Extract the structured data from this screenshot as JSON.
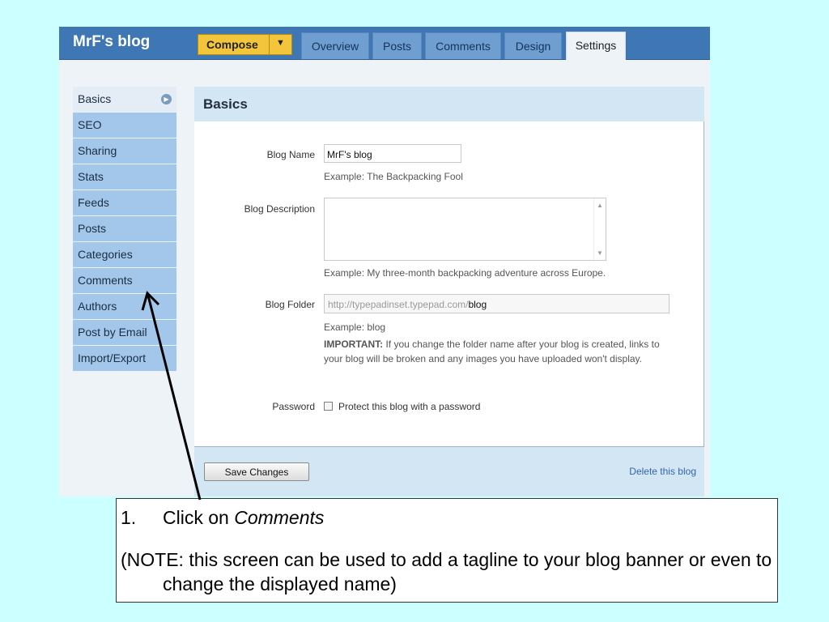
{
  "app": {
    "brand": "MrF's blog",
    "compose": {
      "label": "Compose",
      "caret": "▼"
    },
    "tabs": [
      {
        "label": "Overview"
      },
      {
        "label": "Posts"
      },
      {
        "label": "Comments"
      },
      {
        "label": "Design"
      },
      {
        "label": "Settings",
        "active": true
      }
    ]
  },
  "sidebar": {
    "items": [
      {
        "label": "Basics",
        "active": true
      },
      {
        "label": "SEO"
      },
      {
        "label": "Sharing"
      },
      {
        "label": "Stats"
      },
      {
        "label": "Feeds"
      },
      {
        "label": "Posts"
      },
      {
        "label": "Categories"
      },
      {
        "label": "Comments"
      },
      {
        "label": "Authors"
      },
      {
        "label": "Post by Email"
      },
      {
        "label": "Import/Export"
      }
    ]
  },
  "panel": {
    "title": "Basics",
    "blog_name": {
      "label": "Blog Name",
      "value": "MrF's blog",
      "example": "Example: The Backpacking Fool"
    },
    "blog_description": {
      "label": "Blog Description",
      "value": "",
      "example": "Example: My three-month backpacking adventure across Europe."
    },
    "blog_folder": {
      "label": "Blog Folder",
      "url_prefix": "http://typepadinset.typepad.com/",
      "value": "blog",
      "example": "Example: blog",
      "important_label": "IMPORTANT:",
      "important_text": "If you change the folder name after your blog is created, links to your blog will be broken and any images you have uploaded won't display."
    },
    "password": {
      "label": "Password",
      "checkbox_label": "Protect this blog with a password",
      "checked": false
    },
    "save_label": "Save Changes",
    "delete_label": "Delete this blog"
  },
  "note": {
    "step_number": "1.",
    "step_text_prefix": "Click on ",
    "step_text_emph": "Comments",
    "note_text": "(NOTE: this screen can be used to add a tagline to your blog banner or even to change the displayed name)"
  },
  "colors": {
    "page_background": "#ccffff",
    "topbar": "#3e77b4",
    "compose_button": "#f3c53b",
    "sidebar_item": "#a3c7ea",
    "panel_header": "#d3e6f4"
  }
}
